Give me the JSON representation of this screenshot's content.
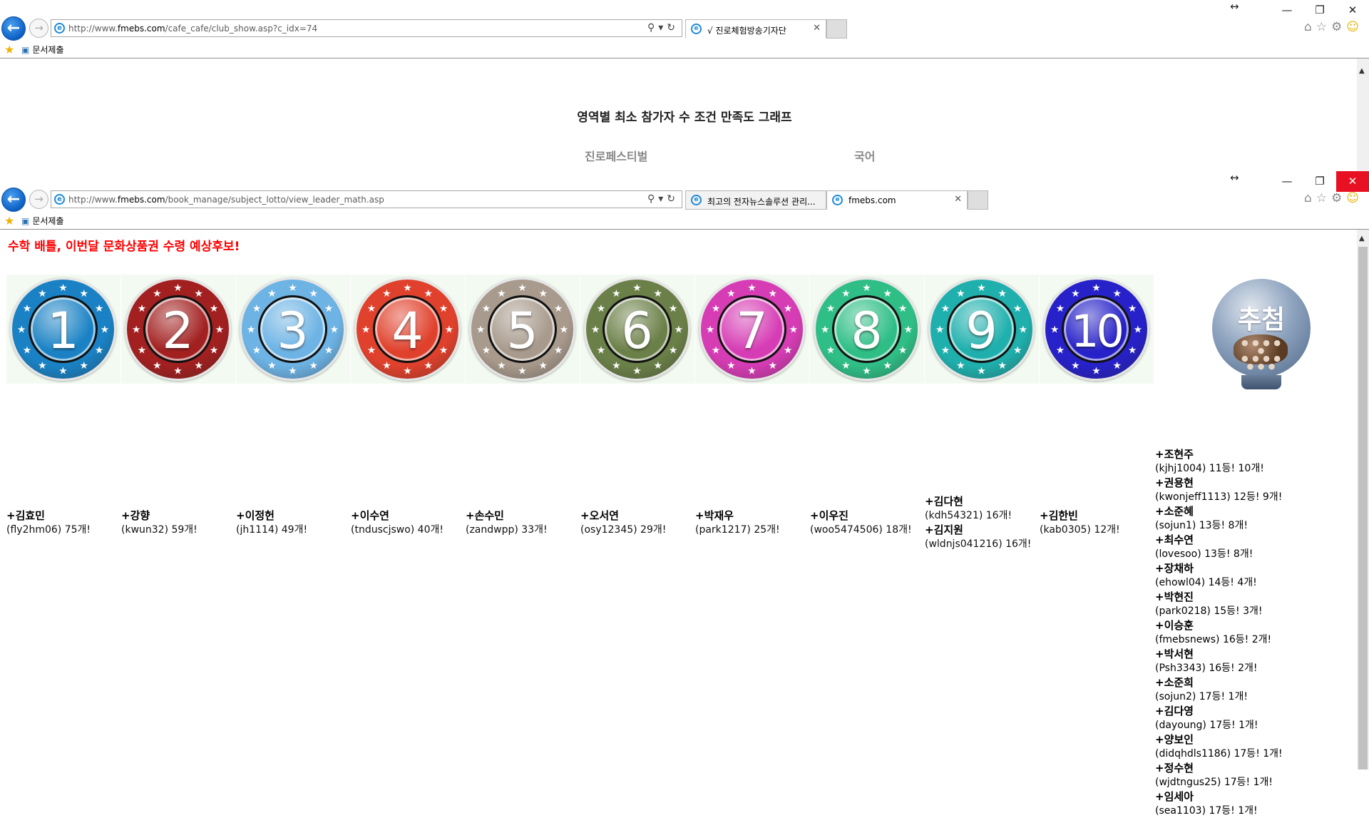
{
  "window1": {
    "url_grey": "http://www.",
    "url_domain": "fmebs.com",
    "url_path": "/cafe_cafe/club_show.asp?c_idx=74",
    "tab_title": "√ 진로체험방송기자단",
    "fav_link": "문서제출",
    "graph_title": "영역별 최소 참가자 수 조건 만족도 그래프",
    "fields": [
      "진로페스티벌",
      "국어"
    ]
  },
  "window2": {
    "url_grey": "http://www.",
    "url_domain": "fmebs.com",
    "url_path": "/book_manage/subject_lotto/view_leader_math.asp",
    "tabs": [
      {
        "title": "최고의 전자뉴스솔루션 관리..."
      },
      {
        "title": "fmebs.com"
      }
    ],
    "fav_link": "문서제출",
    "headline": "수학 배틀, 이번달 문화상품권 수령 예상후보!",
    "balls": [
      {
        "number": "1",
        "color": "#1a82c4"
      },
      {
        "number": "2",
        "color": "#a22020"
      },
      {
        "number": "3",
        "color": "#6db3e4"
      },
      {
        "number": "4",
        "color": "#e0412c"
      },
      {
        "number": "5",
        "color": "#a89a8c"
      },
      {
        "number": "6",
        "color": "#6b8048"
      },
      {
        "number": "7",
        "color": "#d63cb4"
      },
      {
        "number": "8",
        "color": "#2fbf86"
      },
      {
        "number": "9",
        "color": "#1fb0ad"
      },
      {
        "number": "10",
        "color": "#2621c8"
      }
    ],
    "lottery_label": "추첨",
    "winners": [
      {
        "entries": [
          {
            "name": "+김효민",
            "detail": "(fly2hm06) 75개!"
          }
        ]
      },
      {
        "entries": [
          {
            "name": "+강향",
            "detail": "(kwun32) 59개!"
          }
        ]
      },
      {
        "entries": [
          {
            "name": "+이정헌",
            "detail": "(jh1114) 49개!"
          }
        ]
      },
      {
        "entries": [
          {
            "name": "+이수연",
            "detail": "(tnduscjswo) 40개!"
          }
        ]
      },
      {
        "entries": [
          {
            "name": "+손수민",
            "detail": "(zandwpp) 33개!"
          }
        ]
      },
      {
        "entries": [
          {
            "name": "+오서연",
            "detail": "(osy12345) 29개!"
          }
        ]
      },
      {
        "entries": [
          {
            "name": "+박재우",
            "detail": "(park1217) 25개!"
          }
        ]
      },
      {
        "entries": [
          {
            "name": "+이우진",
            "detail": "(woo5474506) 18개!"
          }
        ]
      },
      {
        "entries": [
          {
            "name": "+김다현",
            "detail": "(kdh54321) 16개!"
          },
          {
            "name": "+김지원",
            "detail": "(wldnjs041216) 16개!"
          }
        ]
      },
      {
        "entries": [
          {
            "name": "+김한빈",
            "detail": "(kab0305) 12개!"
          }
        ]
      }
    ],
    "draw_list": [
      {
        "name": "+조현주",
        "detail": "(kjhj1004) 11등! 10개!"
      },
      {
        "name": "+권용현",
        "detail": "(kwonjeff1113) 12등! 9개!"
      },
      {
        "name": "+소준혜",
        "detail": "(sojun1) 13등! 8개!"
      },
      {
        "name": "+최수연",
        "detail": "(lovesoo) 13등! 8개!"
      },
      {
        "name": "+장채하",
        "detail": "(ehowl04) 14등! 4개!"
      },
      {
        "name": "+박현진",
        "detail": "(park0218) 15등! 3개!"
      },
      {
        "name": "+이승훈",
        "detail": "(fmebsnews) 16등! 2개!"
      },
      {
        "name": "+박서현",
        "detail": "(Psh3343) 16등! 2개!"
      },
      {
        "name": "+소준희",
        "detail": "(sojun2) 17등! 1개!"
      },
      {
        "name": "+김다영",
        "detail": "(dayoung) 17등! 1개!"
      },
      {
        "name": "+양보인",
        "detail": "(didqhdls1186) 17등! 1개!"
      },
      {
        "name": "+정수현",
        "detail": "(wjdtngus25) 17등! 1개!"
      },
      {
        "name": "+임세아",
        "detail": "(sea1103) 17등! 1개!"
      }
    ]
  }
}
